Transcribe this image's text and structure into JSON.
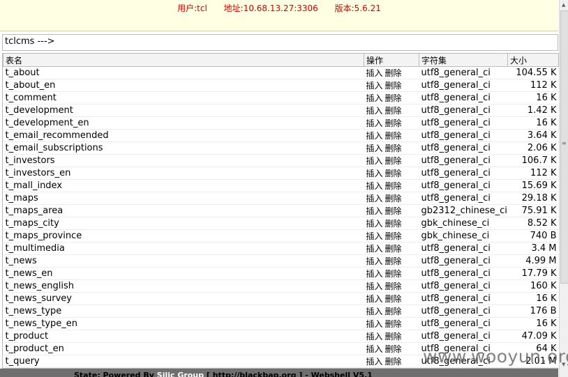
{
  "info": {
    "user": "用户:tcl",
    "address": "地址:10.68.13.27:3306",
    "version": "版本:5.6.21"
  },
  "path": "tclcms --->",
  "headers": [
    "表名",
    "操作",
    "字符集",
    "大小"
  ],
  "ops": {
    "insert": "插入",
    "delete": "删除"
  },
  "rows": [
    {
      "name": "t_about",
      "charset": "utf8_general_ci",
      "size": "104.55 K"
    },
    {
      "name": "t_about_en",
      "charset": "utf8_general_ci",
      "size": "112 K"
    },
    {
      "name": "t_comment",
      "charset": "utf8_general_ci",
      "size": "16 K"
    },
    {
      "name": "t_development",
      "charset": "utf8_general_ci",
      "size": "1.42 K"
    },
    {
      "name": "t_development_en",
      "charset": "utf8_general_ci",
      "size": "16 K"
    },
    {
      "name": "t_email_recommended",
      "charset": "utf8_general_ci",
      "size": "3.64 K"
    },
    {
      "name": "t_email_subscriptions",
      "charset": "utf8_general_ci",
      "size": "2.06 K"
    },
    {
      "name": "t_investors",
      "charset": "utf8_general_ci",
      "size": "106.7 K"
    },
    {
      "name": "t_investors_en",
      "charset": "utf8_general_ci",
      "size": "112 K"
    },
    {
      "name": "t_mall_index",
      "charset": "utf8_general_ci",
      "size": "15.69 K"
    },
    {
      "name": "t_maps",
      "charset": "utf8_general_ci",
      "size": "29.18 K"
    },
    {
      "name": "t_maps_area",
      "charset": "gb2312_chinese_ci",
      "size": "75.91 K"
    },
    {
      "name": "t_maps_city",
      "charset": "gbk_chinese_ci",
      "size": "8.52 K"
    },
    {
      "name": "t_maps_province",
      "charset": "gbk_chinese_ci",
      "size": "740 B"
    },
    {
      "name": "t_multimedia",
      "charset": "utf8_general_ci",
      "size": "3.4 M"
    },
    {
      "name": "t_news",
      "charset": "utf8_general_ci",
      "size": "4.99 M"
    },
    {
      "name": "t_news_en",
      "charset": "utf8_general_ci",
      "size": "17.79 K"
    },
    {
      "name": "t_news_english",
      "charset": "utf8_general_ci",
      "size": "160 K"
    },
    {
      "name": "t_news_survey",
      "charset": "utf8_general_ci",
      "size": "16 K"
    },
    {
      "name": "t_news_type",
      "charset": "utf8_general_ci",
      "size": "176 B"
    },
    {
      "name": "t_news_type_en",
      "charset": "utf8_general_ci",
      "size": "16 K"
    },
    {
      "name": "t_product",
      "charset": "utf8_general_ci",
      "size": "47.09 K"
    },
    {
      "name": "t_product_en",
      "charset": "utf8_general_ci",
      "size": "64 K"
    },
    {
      "name": "t_query",
      "charset": "utf8_general_ci",
      "size": "2.01 M"
    }
  ],
  "status": {
    "prefix": "State: Powered By ",
    "group": "Silic Group",
    "middle": " [ http://blackbap.org ] - Webshell V5.1"
  },
  "watermark": "www.wooyun.org",
  "icons": {
    "up": "scroll-up-icon",
    "down": "scroll-down-icon",
    "grip": "scroll-grip-icon"
  },
  "colors": {
    "info_text": "#cc0000",
    "info_bg": "#ffffe3",
    "status_bg": "#6f6f6f"
  }
}
